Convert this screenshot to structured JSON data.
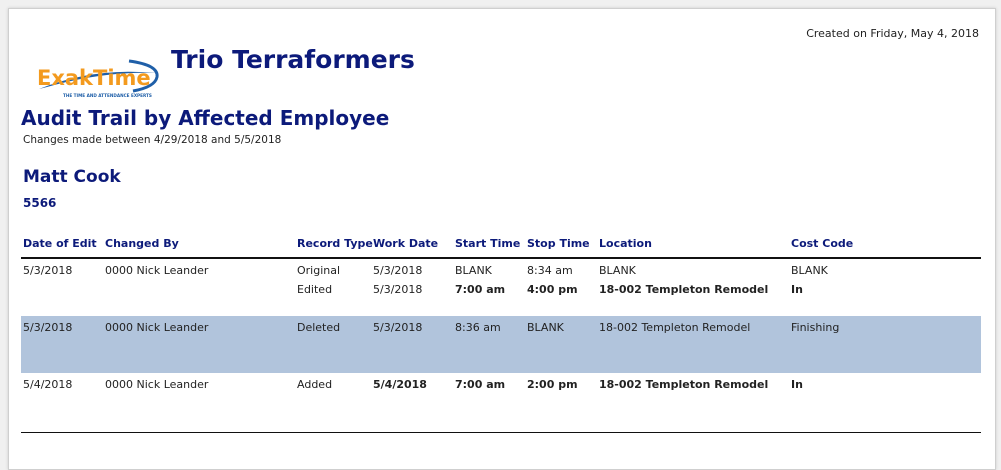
{
  "created_on": "Created on Friday, May 4, 2018",
  "logo": {
    "text": "ExakTime",
    "tagline": "THE TIME AND ATTENDANCE EXPERTS"
  },
  "company": "Trio Terraformers",
  "report": {
    "title": "Audit Trail by Affected Employee",
    "range": "Changes made between 4/29/2018 and 5/5/2018"
  },
  "employee": {
    "name": "Matt Cook",
    "number": "5566"
  },
  "columns": [
    "Date of Edit",
    "Changed By",
    "Record Type",
    "Work Date",
    "Start Time",
    "Stop Time",
    "Location",
    "Cost Code"
  ],
  "records": [
    {
      "date_of_edit": "5/3/2018",
      "changed_by": "0000  Nick Leander",
      "highlight": false,
      "lines": [
        {
          "record_type": "Original",
          "work_date": "5/3/2018",
          "start_time": "BLANK",
          "stop_time": "8:34 am",
          "location": "BLANK",
          "cost_code": "BLANK",
          "bold": false
        },
        {
          "record_type": "Edited",
          "work_date": "5/3/2018",
          "start_time": "7:00 am",
          "stop_time": "4:00 pm",
          "location": "18-002  Templeton Remodel",
          "cost_code": "In",
          "bold": true
        }
      ]
    },
    {
      "date_of_edit": "5/3/2018",
      "changed_by": "0000  Nick Leander",
      "highlight": true,
      "lines": [
        {
          "record_type": "Deleted",
          "work_date": "5/3/2018",
          "start_time": "8:36 am",
          "stop_time": "BLANK",
          "location": "18-002  Templeton Remodel",
          "cost_code": "Finishing",
          "bold": false
        }
      ]
    },
    {
      "date_of_edit": "5/4/2018",
      "changed_by": "0000  Nick Leander",
      "highlight": false,
      "lines": [
        {
          "record_type": "Added",
          "work_date": "5/4/2018",
          "start_time": "7:00 am",
          "stop_time": "2:00 pm",
          "location": "18-002  Templeton Remodel",
          "cost_code": "In",
          "bold": true
        }
      ]
    }
  ],
  "colors": {
    "heading": "#0c1a7a",
    "highlight_row": "#b1c4dc",
    "logo_orange": "#f39a1e",
    "logo_blue": "#1f5fa8"
  }
}
